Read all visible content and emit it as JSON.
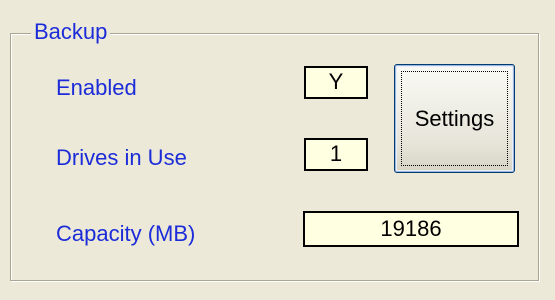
{
  "backup_group": {
    "title": "Backup",
    "enabled": {
      "label": "Enabled",
      "value": "Y"
    },
    "drives_in_use": {
      "label": "Drives in Use",
      "value": "1"
    },
    "capacity": {
      "label": "Capacity (MB)",
      "value": "19186"
    },
    "settings_button_label": "Settings"
  },
  "colors": {
    "background": "#ece9d8",
    "label_text": "#1c2cd8",
    "field_background": "#ffffe1",
    "button_border": "#003c74"
  }
}
